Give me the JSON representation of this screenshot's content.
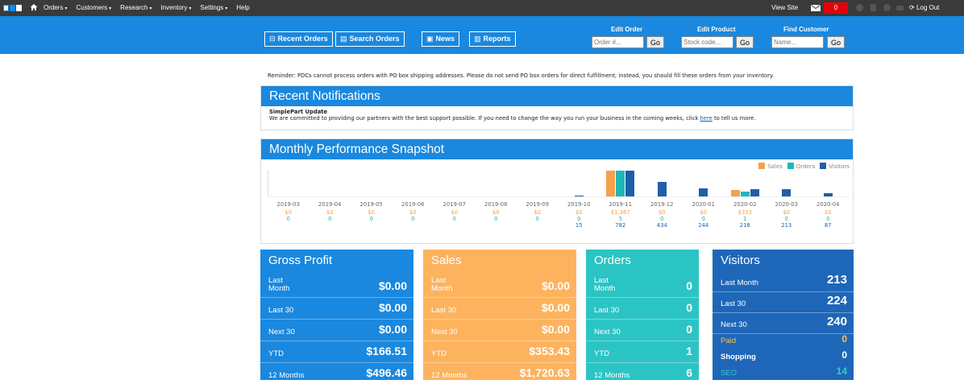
{
  "topbar": {
    "menu": [
      "Orders",
      "Customers",
      "Research",
      "Inventory",
      "Settings",
      "Help"
    ],
    "menu_carets": [
      "▾",
      "▾",
      "▾",
      "▾",
      "▾",
      ""
    ],
    "view_site": "View Site",
    "badge_count": "0",
    "log_out": "Log Out"
  },
  "header": {
    "buttons": [
      "Recent Orders",
      "Search Orders",
      "News",
      "Reports"
    ],
    "edit_order": {
      "title": "Edit Order",
      "placeholder": "Order #...",
      "go": "Go"
    },
    "edit_product": {
      "title": "Edit Product",
      "placeholder": "Stock code...",
      "go": "Go"
    },
    "find_customer": {
      "title": "Find Customer",
      "placeholder": "Name...",
      "go": "Go"
    }
  },
  "reminder": "Reminder: PDCs cannot process orders with PO box shipping addresses. Please do not send PO box orders for direct fulfillment; instead, you should fill these orders from your inventory.",
  "notifications": {
    "title": "Recent Notifications",
    "item_title": "SimplePart Update",
    "item_text_before": "We are committed to providing our partners with the best support possible. If you need to change the way you run your business in the coming weeks, click ",
    "item_link": "here",
    "item_text_after": " to tell us more."
  },
  "snapshot": {
    "title": "Monthly Performance Snapshot"
  },
  "chart_data": {
    "type": "bar",
    "categories": [
      "2019-03",
      "2019-04",
      "2019-05",
      "2019-06",
      "2019-07",
      "2019-08",
      "2019-09",
      "2019-10",
      "2019-11",
      "2019-12",
      "2020-01",
      "2020-02",
      "2020-03",
      "2020-04"
    ],
    "series": [
      {
        "name": "Sales",
        "color": "#f5a04a",
        "labels": [
          "$0",
          "$0",
          "$0",
          "$0",
          "$0",
          "$0",
          "$0",
          "$0",
          "$1,367",
          "$0",
          "$0",
          "$353",
          "$0",
          "$0"
        ],
        "values": [
          0,
          0,
          0,
          0,
          0,
          0,
          0,
          0,
          1367,
          0,
          0,
          353,
          0,
          0
        ]
      },
      {
        "name": "Orders",
        "color": "#1cb8b8",
        "labels": [
          "0",
          "0",
          "0",
          "0",
          "0",
          "0",
          "0",
          "0",
          "5",
          "0",
          "0",
          "1",
          "0",
          "0"
        ],
        "values": [
          0,
          0,
          0,
          0,
          0,
          0,
          0,
          0,
          5,
          0,
          0,
          1,
          0,
          0
        ]
      },
      {
        "name": "Visitors",
        "color": "#1f5fa8",
        "labels": [
          "",
          "",
          "",
          "",
          "",
          "",
          "",
          "15",
          "782",
          "434",
          "244",
          "218",
          "213",
          "87"
        ],
        "values": [
          0,
          0,
          0,
          0,
          0,
          0,
          0,
          15,
          782,
          434,
          244,
          218,
          213,
          87
        ]
      }
    ],
    "legend": [
      "Sales",
      "Orders",
      "Visitors"
    ],
    "legend_position": "top-right"
  },
  "cards": {
    "gross_profit": {
      "title": "Gross Profit",
      "rows": [
        {
          "label": "Last Month",
          "value": "$0.00"
        },
        {
          "label": "Last 30",
          "value": "$0.00"
        },
        {
          "label": "Next 30",
          "value": "$0.00"
        },
        {
          "label": "YTD",
          "value": "$166.51"
        },
        {
          "label": "12 Months",
          "value": "$496.46"
        }
      ]
    },
    "sales": {
      "title": "Sales",
      "rows": [
        {
          "label": "Last Month",
          "value": "$0.00"
        },
        {
          "label": "Last 30",
          "value": "$0.00"
        },
        {
          "label": "Next 30",
          "value": "$0.00"
        },
        {
          "label": "YTD",
          "value": "$353.43"
        },
        {
          "label": "12 Months",
          "value": "$1,720.63"
        }
      ]
    },
    "orders": {
      "title": "Orders",
      "rows": [
        {
          "label": "Last Month",
          "value": "0"
        },
        {
          "label": "Last 30",
          "value": "0"
        },
        {
          "label": "Next 30",
          "value": "0"
        },
        {
          "label": "YTD",
          "value": "1"
        },
        {
          "label": "12 Months",
          "value": "6"
        }
      ]
    },
    "visitors": {
      "title": "Visitors",
      "rows": [
        {
          "label": "Last Month",
          "value": "213"
        },
        {
          "label": "Last 30",
          "value": "224"
        },
        {
          "label": "Next 30",
          "value": "240"
        },
        {
          "label": "Paid",
          "value": "0"
        },
        {
          "label": "Shopping",
          "value": "0"
        },
        {
          "label": "SEO",
          "value": "14"
        }
      ]
    }
  },
  "colors": {
    "brand_blue": "#1a88de",
    "sales_orange": "#fdb35d",
    "orders_teal": "#2bc4c4",
    "visitors_blue": "#1e67b8",
    "badge_red": "#e3000f"
  }
}
